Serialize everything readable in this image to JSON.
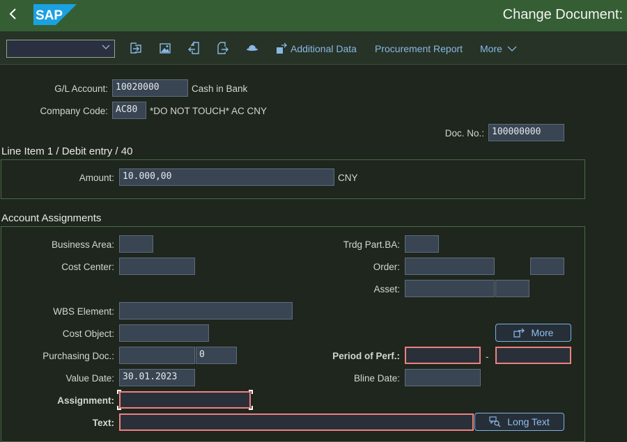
{
  "shell": {
    "back_icon": "chevron-left-icon",
    "logo_text": "SAP",
    "title": "Change Document:"
  },
  "toolbar": {
    "dropdown_value": "",
    "icons": [
      "import-icon",
      "image-icon",
      "document-back-icon",
      "document-forward-icon",
      "hat-icon"
    ],
    "additional_data_label": "Additional Data",
    "procurement_report_label": "Procurement Report",
    "more_label": "More"
  },
  "header": {
    "gl_account_label": "G/L Account:",
    "gl_account_value": "10020000",
    "gl_account_desc": "Cash in Bank",
    "company_code_label": "Company Code:",
    "company_code_value": "AC80",
    "company_code_desc": "*DO NOT TOUCH* AC CNY",
    "doc_no_label": "Doc. No.:",
    "doc_no_value": "100000000"
  },
  "line_item": {
    "title": "Line Item 1 / Debit entry / 40",
    "amount_label": "Amount:",
    "amount_value": "10.000,00",
    "currency": "CNY"
  },
  "account_assignments": {
    "title": "Account Assignments",
    "business_area_label": "Business Area:",
    "business_area_value": "",
    "trdg_part_ba_label": "Trdg Part.BA:",
    "trdg_part_ba_value": "",
    "cost_center_label": "Cost Center:",
    "cost_center_value": "",
    "order_label": "Order:",
    "order_value": "",
    "order_extra_value": "",
    "asset_label": "Asset:",
    "asset_value": "",
    "asset_sub_value": "",
    "wbs_label": "WBS Element:",
    "wbs_value": "",
    "cost_object_label": "Cost Object:",
    "cost_object_value": "",
    "more_button": "More",
    "purchasing_doc_label": "Purchasing Doc.:",
    "purchasing_doc_value": "",
    "purchasing_doc_item": "0",
    "period_label": "Period of Perf.:",
    "period_from": "",
    "period_sep": "-",
    "period_to": "",
    "value_date_label": "Value Date:",
    "value_date_value": "30.01.2023",
    "bline_date_label": "Bline Date:",
    "bline_date_value": "",
    "assignment_label": "Assignment:",
    "assignment_value": "",
    "text_label": "Text:",
    "text_value": "",
    "long_text_button": "Long Text"
  },
  "colors": {
    "shell_bg": "#355e35",
    "toolbar_bg": "#273326",
    "page_bg": "#1e261d",
    "link": "#89b8e6",
    "required_border": "#f08080",
    "sap_blue": "#1ba1e2"
  }
}
